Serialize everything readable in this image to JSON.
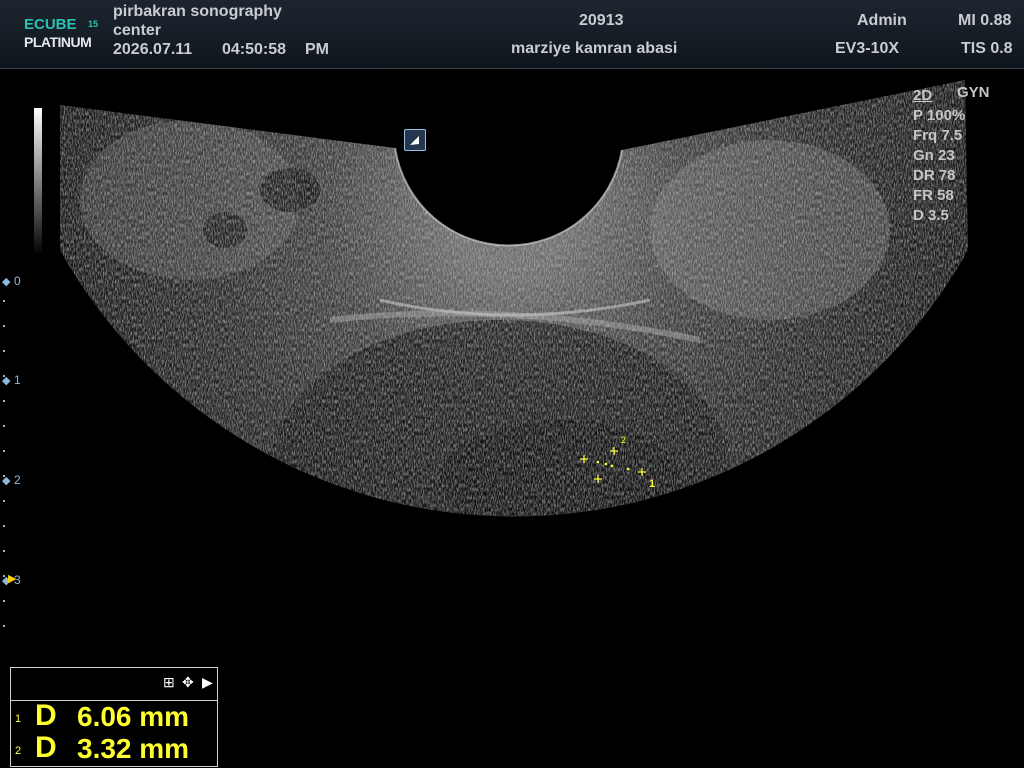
{
  "header": {
    "brand_top": "ECUBE",
    "brand_num": "15",
    "brand_bottom": "PLATINUM",
    "center_line1": "pirbakran sonography",
    "center_line2": "center",
    "date": "2026.07.11",
    "time": "04:50:58",
    "ampm": "PM",
    "patient_id": "20913",
    "patient_name": "marziye kamran abasi",
    "user": "Admin",
    "probe": "EV3-10X",
    "mi": "MI 0.88",
    "tis": "TIS 0.8"
  },
  "preset": "GYN",
  "imaging": {
    "mode": "2D",
    "power": "P 100%",
    "frequency": "Frq 7.5",
    "gain": "Gn 23",
    "dynamic_range": "DR 78",
    "frame_rate": "FR 58",
    "depth": "D 3.5"
  },
  "depth_scale": [
    "0",
    "1",
    "2",
    "3"
  ],
  "markers": {
    "label1": "1",
    "label2": "2"
  },
  "measurements": [
    {
      "index": "1",
      "label": "D",
      "value": "6.06 mm"
    },
    {
      "index": "2",
      "label": "D",
      "value": "3.32 mm"
    }
  ],
  "colors": {
    "caliper": "#ffff30",
    "accent": "#2dbfb0",
    "depth_marker": "#8fb8dc"
  },
  "icons": [
    "grid-icon",
    "move-icon",
    "play-arrow-icon",
    "body-marker-icon"
  ]
}
